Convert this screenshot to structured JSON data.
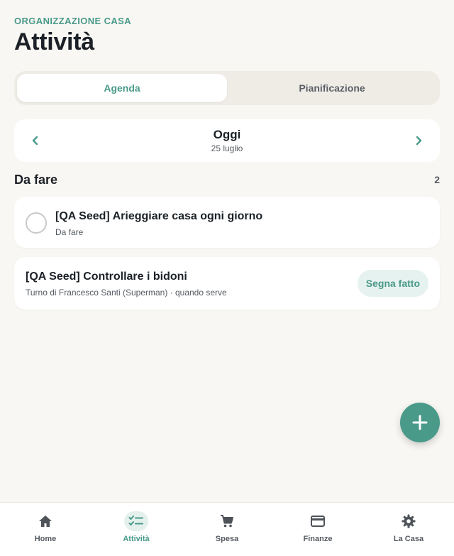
{
  "header": {
    "eyebrow": "ORGANIZZAZIONE CASA",
    "title": "Attività"
  },
  "segments": {
    "agenda": "Agenda",
    "planning": "Pianificazione",
    "active": "agenda"
  },
  "date_nav": {
    "main": "Oggi",
    "sub": "25 luglio",
    "prev_icon": "chevron-left-icon",
    "next_icon": "chevron-right-icon"
  },
  "section": {
    "title": "Da fare",
    "count": "2"
  },
  "tasks": [
    {
      "title": "[QA Seed] Arieggiare casa ogni giorno",
      "subtitle": "Da fare"
    },
    {
      "title": "[QA Seed] Controllare i bidoni",
      "subtitle": "Turno di Francesco Santi (Superman) · quando serve",
      "action": "Segna fatto"
    }
  ],
  "fab": {
    "icon": "plus-icon"
  },
  "tabbar": [
    {
      "label": "Home",
      "icon": "home-icon"
    },
    {
      "label": "Attività",
      "icon": "checklist-icon",
      "active": true
    },
    {
      "label": "Spesa",
      "icon": "cart-icon"
    },
    {
      "label": "Finanze",
      "icon": "credit-card-icon"
    },
    {
      "label": "La Casa",
      "icon": "gear-icon"
    }
  ],
  "colors": {
    "accent": "#4a9a8a",
    "background": "#f9f7f3",
    "accent_soft": "#e6f2ef"
  }
}
